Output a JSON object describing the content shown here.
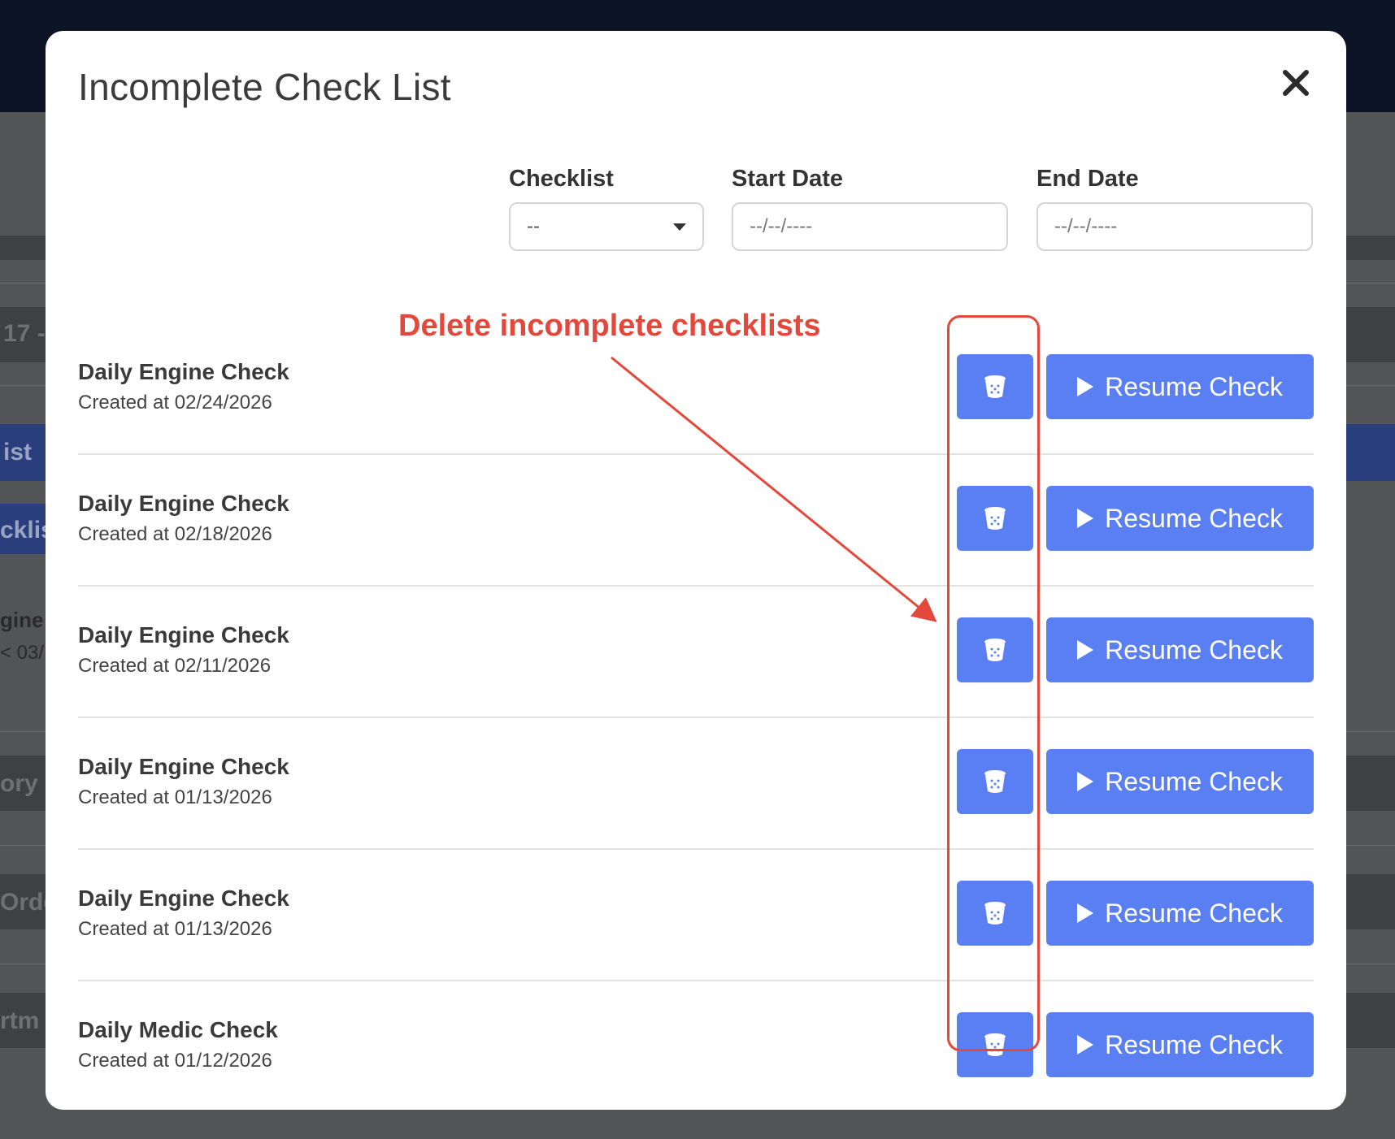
{
  "background": {
    "fragments": [
      "17 -",
      "ist",
      "cklis",
      "gine (",
      "< 03/",
      "ory I",
      "Orde",
      "rtm"
    ]
  },
  "modal": {
    "title": "Incomplete Check List"
  },
  "filters": {
    "checklist": {
      "label": "Checklist",
      "value": "--"
    },
    "start_date": {
      "label": "Start Date",
      "placeholder": "--/--/----"
    },
    "end_date": {
      "label": "End Date",
      "placeholder": "--/--/----"
    }
  },
  "rows": [
    {
      "title": "Daily Engine Check",
      "created": "Created at 02/24/2026",
      "resume_label": "Resume Check"
    },
    {
      "title": "Daily Engine Check",
      "created": "Created at 02/18/2026",
      "resume_label": "Resume Check"
    },
    {
      "title": "Daily Engine Check",
      "created": "Created at 02/11/2026",
      "resume_label": "Resume Check"
    },
    {
      "title": "Daily Engine Check",
      "created": "Created at 01/13/2026",
      "resume_label": "Resume Check"
    },
    {
      "title": "Daily Engine Check",
      "created": "Created at 01/13/2026",
      "resume_label": "Resume Check"
    },
    {
      "title": "Daily Medic Check",
      "created": "Created at 01/12/2026",
      "resume_label": "Resume Check"
    }
  ],
  "annotation": {
    "text": "Delete incomplete checklists",
    "color": "#e4483b"
  },
  "colors": {
    "button": "#5a7ff2",
    "topbar": "#0c1325"
  },
  "icons": {
    "close": "close-icon",
    "delete": "trash-icon",
    "resume": "play-icon",
    "select": "caret-down-icon"
  }
}
